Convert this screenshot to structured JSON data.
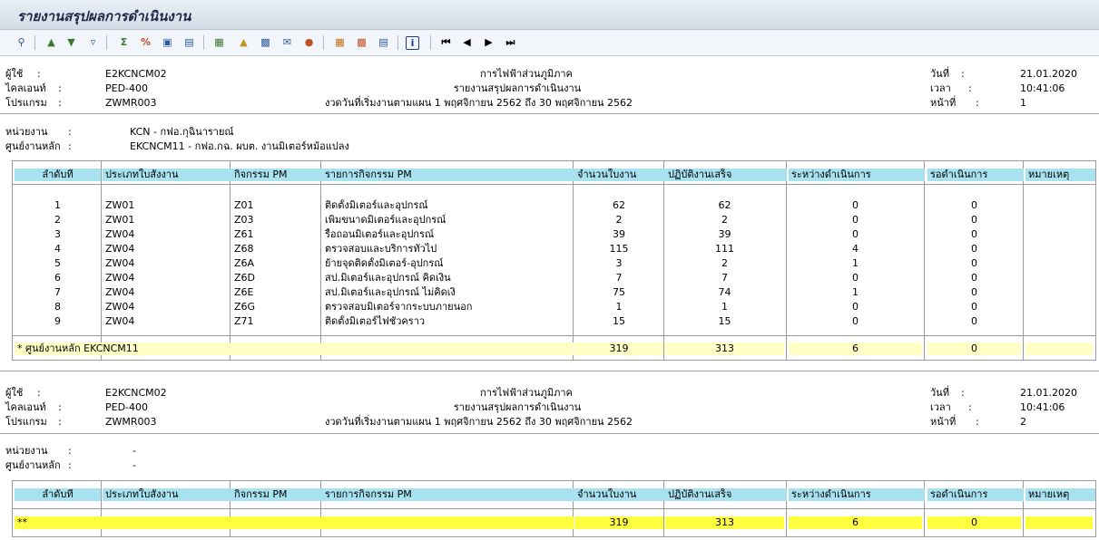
{
  "window": {
    "title": "รายงานสรุปผลการดำเนินงาน"
  },
  "toolbar": {
    "icons": [
      "details-icon",
      "sort-ascending-icon",
      "sort-descending-icon",
      "filter-icon",
      "total-icon",
      "subtotal-icon",
      "select-layout-icon",
      "change-layout-icon",
      "export-spreadsheet-icon",
      "export-word-icon",
      "local-file-icon",
      "send-mail-icon",
      "abc-analysis-icon",
      "graphic-icon",
      "print-icon",
      "save-layout-icon",
      "information-icon",
      "first-page-icon",
      "previous-page-icon",
      "next-page-icon",
      "last-page-icon"
    ]
  },
  "labels": {
    "user": "ผู้ใช้",
    "client": "ไคลเอนท์",
    "program": "โปรแกรม",
    "date": "วันที่",
    "time": "เวลา",
    "page": "หน้าที่",
    "colon": ":",
    "unit": "หน่วยงาน",
    "center": "ศูนย์งานหลัก"
  },
  "columns": [
    "ลำดับที่",
    "ประเภทใบสั่งงาน",
    "กิจกรรม PM",
    "รายการกิจกรรม PM",
    "จำนวนใบงาน",
    "ปฏิบัติงานเสร็จ",
    "ระหว่างดำเนินการ",
    "รอดำเนินการ",
    "หมายเหตุ"
  ],
  "page1": {
    "user": "E2KCNCM02",
    "client": "PED-400",
    "program": "ZWMR003",
    "org": "การไฟฟ้าส่วนภูมิภาค",
    "report_title": "รายงานสรุปผลการดำเนินงาน",
    "period": "งวดวันที่เริ่มงานตามแผน 1 พฤศจิกายน 2562 ถึง 30 พฤศจิกายน 2562",
    "date": "21.01.2020",
    "time": "10:41:06",
    "page": "1",
    "unit": "KCN - กฟอ.กุฉินารายณ์",
    "center": "EKCNCM11 - กฟอ.กฉ. ผบต. งานมิเตอร์หม้อแปลง",
    "rows": [
      [
        "1",
        "ZW01",
        "Z01",
        "ติดตั้งมิเตอร์และอุปกรณ์",
        "62",
        "62",
        "0",
        "0",
        ""
      ],
      [
        "2",
        "ZW01",
        "Z03",
        "เพิ่มขนาดมิเตอร์และอุปกรณ์",
        "2",
        "2",
        "0",
        "0",
        ""
      ],
      [
        "3",
        "ZW04",
        "Z61",
        "รื้อถอนมิเตอร์และอุปกรณ์",
        "39",
        "39",
        "0",
        "0",
        ""
      ],
      [
        "4",
        "ZW04",
        "Z68",
        "ตรวจสอบและบริการทั่วไป",
        "115",
        "111",
        "4",
        "0",
        ""
      ],
      [
        "5",
        "ZW04",
        "Z6A",
        "ย้ายจุดติดตั้งมิเตอร์-อุปกรณ์",
        "3",
        "2",
        "1",
        "0",
        ""
      ],
      [
        "6",
        "ZW04",
        "Z6D",
        "สป.มิเตอร์และอุปกรณ์ คิดเงิน",
        "7",
        "7",
        "0",
        "0",
        ""
      ],
      [
        "7",
        "ZW04",
        "Z6E",
        "สป.มิเตอร์และอุปกรณ์ ไม่คิดเงิ",
        "75",
        "74",
        "1",
        "0",
        ""
      ],
      [
        "8",
        "ZW04",
        "Z6G",
        "ตรวจสอบมิเตอร์จากระบบภายนอก",
        "1",
        "1",
        "0",
        "0",
        ""
      ],
      [
        "9",
        "ZW04",
        "Z71",
        "ติดตั้งมิเตอร์ไฟชั่วคราว",
        "15",
        "15",
        "0",
        "0",
        ""
      ]
    ],
    "subtotal": {
      "label": "*  ศูนย์งานหลัก EKCNCM11",
      "count": "319",
      "done": "313",
      "inprog": "6",
      "wait": "0"
    }
  },
  "page2": {
    "user": "E2KCNCM02",
    "client": "PED-400",
    "program": "ZWMR003",
    "org": "การไฟฟ้าส่วนภูมิภาค",
    "report_title": "รายงานสรุปผลการดำเนินงาน",
    "period": "งวดวันที่เริ่มงานตามแผน 1 พฤศจิกายน 2562 ถึง 30 พฤศจิกายน 2562",
    "date": "21.01.2020",
    "time": "10:41:06",
    "page": "2",
    "unit": "-",
    "center": "-",
    "total": {
      "label": "**",
      "count": "319",
      "done": "313",
      "inprog": "6",
      "wait": "0"
    }
  }
}
